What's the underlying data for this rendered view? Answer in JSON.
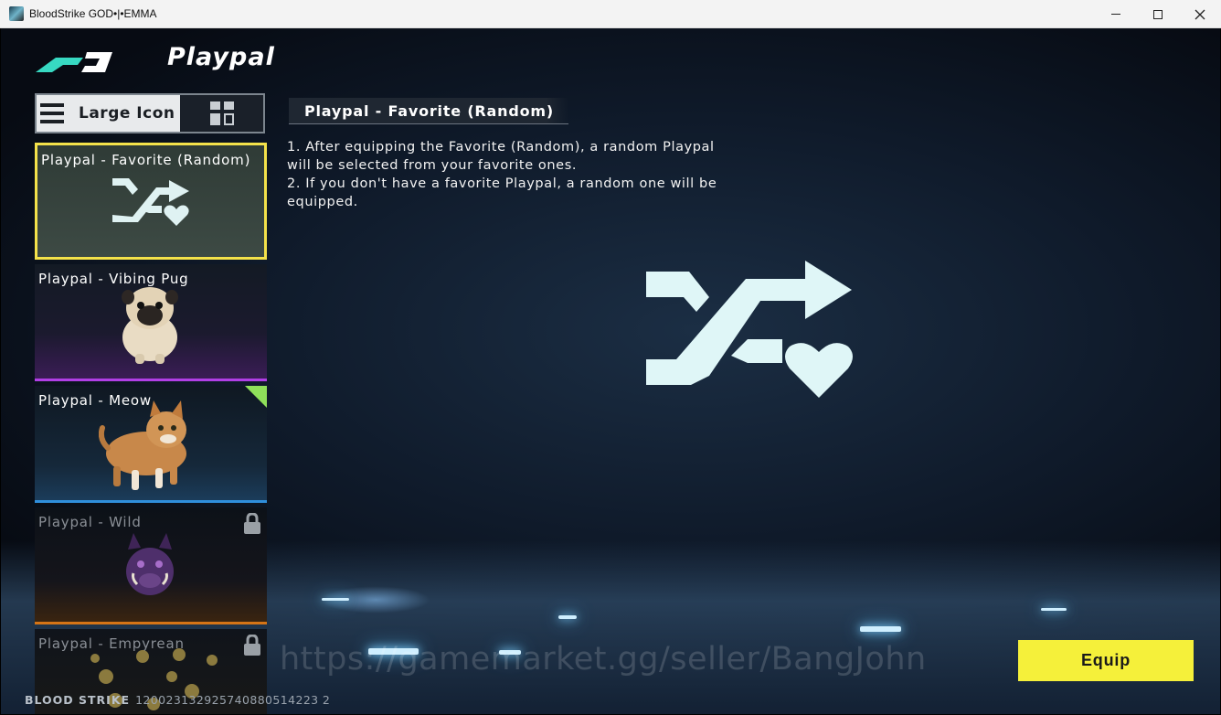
{
  "window": {
    "title": "BloodStrike GOD•|•EMMA",
    "minimize_label": "—",
    "maximize_label": "☐",
    "close_label": "✕"
  },
  "header": {
    "title": "Playpal"
  },
  "view_toggle": {
    "large_icon_label": "Large Icon",
    "selected": "large-icon"
  },
  "playpals": [
    {
      "name": "Playpal - Favorite (Random)",
      "selected": true,
      "locked": false,
      "icon": "shuffle-heart-icon"
    },
    {
      "name": "Playpal - Vibing Pug",
      "selected": false,
      "locked": false,
      "icon": "pug-icon",
      "rarity_color": "#b13fe6"
    },
    {
      "name": "Playpal - Meow",
      "selected": false,
      "locked": false,
      "icon": "cat-icon",
      "rarity_color": "#2f8fdc",
      "new_badge": true
    },
    {
      "name": "Playpal - Wild",
      "selected": false,
      "locked": true,
      "icon": "boar-icon",
      "rarity_color": "#d57416"
    },
    {
      "name": "Playpal - Empyrean",
      "selected": false,
      "locked": true,
      "icon": "coin-icon"
    }
  ],
  "detail": {
    "title": "Playpal - Favorite (Random)",
    "description_line1": "1. After equipping the Favorite (Random), a random Playpal will be selected from your favorite ones.",
    "description_line2": "2. If you don't have a favorite Playpal, a random one will be equipped."
  },
  "equip_label": "Equip",
  "watermark": "https://gamemarket.gg/seller/BangJohn",
  "footer": {
    "brand": "BLOOD STRIKE",
    "id": "120023132925740880514223 2"
  },
  "colors": {
    "selected_border": "#f4e24a",
    "equip_button": "#f5f03a"
  }
}
